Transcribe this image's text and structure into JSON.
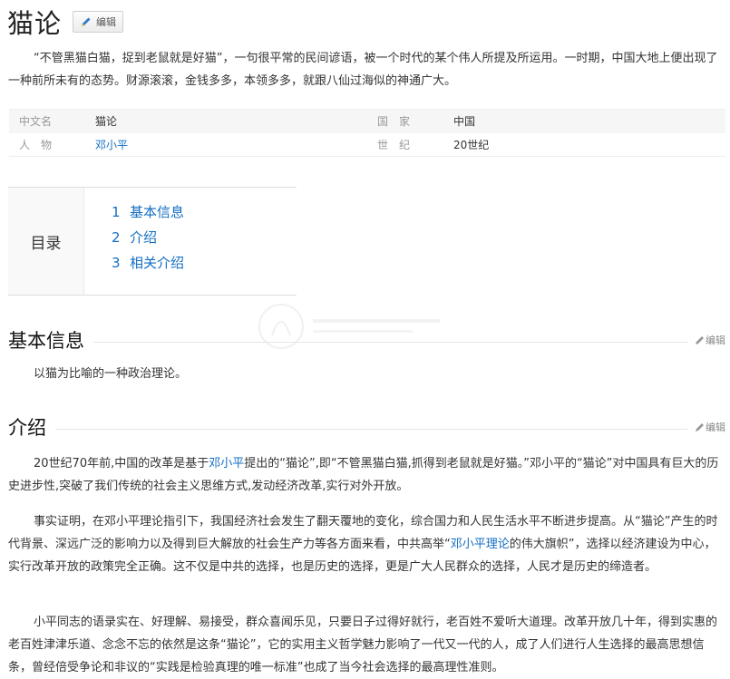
{
  "page": {
    "title": "猫论",
    "edit_label": "编辑",
    "summary": "“不管黑猫白猫，捉到老鼠就是好猫”，一句很平常的民间谚语，被一个时代的某个伟人所提及所运用。一时期，中国大地上便出现了一种前所未有的态势。财源滚滚，金钱多多，本领多多，就跟八仙过海似的神通广大。"
  },
  "infobox": {
    "k1": "中文名",
    "v1": "猫论",
    "k2": "国　家",
    "v2": "中国",
    "k3": "人　物",
    "v3": "邓小平",
    "k4": "世　纪",
    "v4": "20世纪"
  },
  "toc": {
    "label": "目录",
    "items": [
      {
        "num": "1",
        "label": "基本信息"
      },
      {
        "num": "2",
        "label": "介绍"
      },
      {
        "num": "3",
        "label": "相关介绍"
      }
    ]
  },
  "sections": {
    "basic": {
      "title": "基本信息",
      "edit": "编辑",
      "text": "以猫为比喻的一种政治理论。"
    },
    "intro": {
      "title": "介绍",
      "edit": "编辑",
      "p1_a": "20世纪70年前,中国的改革是基于",
      "p1_link": "邓小平",
      "p1_b": "提出的“猫论”,即“不管黑猫白猫,抓得到老鼠就是好猫。”邓小平的“猫论”对中国具有巨大的历史进步性,突破了我们传统的社会主义思维方式,发动经济改革,实行对外开放。",
      "p2_a": "事实证明，在邓小平理论指引下，我国经济社会发生了翻天覆地的变化，综合国力和人民生活水平不断进步提高。从“猫论”产生的时代背景、深远广泛的影响力以及得到巨大解放的社会生产力等各方面来看，中共高举“",
      "p2_link": "邓小平理论",
      "p2_b": "的伟大旗帜”，选择以经济建设为中心，实行改革开放的政策完全正确。这不仅是中共的选择，也是历史的选择，更是广大人民群众的选择，人民才是历史的缔造者。",
      "p3": "小平同志的语录实在、好理解、易接受，群众喜闻乐见，只要日子过得好就行，老百姓不爱听大道理。改革开放几十年，得到实惠的老百姓津津乐道、念念不忘的依然是这条“猫论”，它的实用主义哲学魅力影响了一代又一代的人，成了人们进行人生选择的最高思想信条，曾经倍受争论和非议的“实践是检验真理的唯一标准”也成了当今社会选择的最高理性准则。"
    }
  },
  "colors": {
    "link": "#136ec2",
    "text": "#333333",
    "muted": "#999999"
  }
}
